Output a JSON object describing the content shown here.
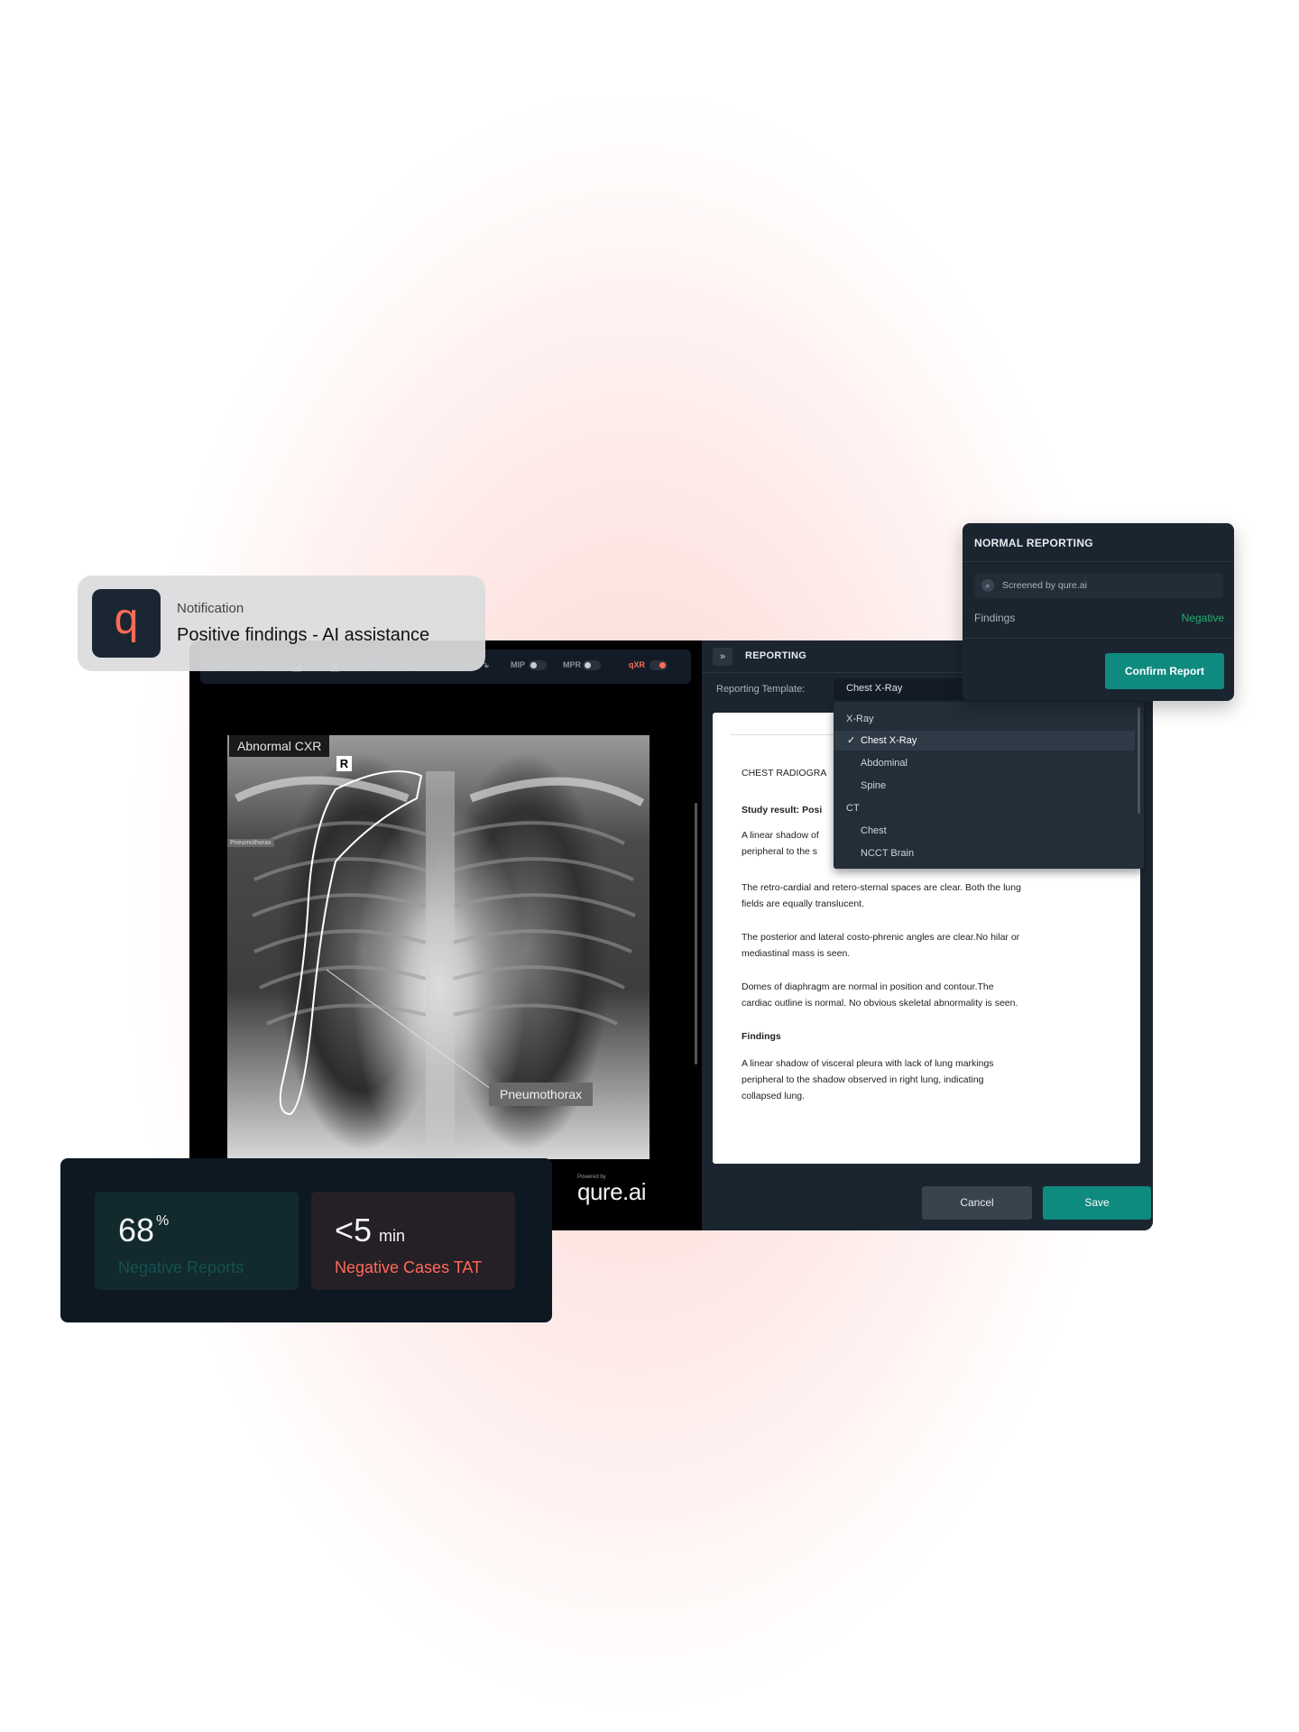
{
  "notification": {
    "title": "Notification",
    "message": "Positive findings - AI assistance",
    "logo_glyph": "q"
  },
  "toolbar": {
    "mip_label": "MIP",
    "mpr_label": "MPR",
    "qxr_label": "qXR",
    "qxr_on": true
  },
  "viewer": {
    "abnormal_label": "Abnormal CXR",
    "r_marker": "R",
    "small_label": "Pneumothorax",
    "finding_label": "Pneumothorax"
  },
  "reporting": {
    "title": "REPORTING",
    "template_label": "Reporting Template:",
    "template_value": "Chest X-Ray",
    "dropdown": [
      {
        "label": "X-Ray",
        "type": "group"
      },
      {
        "label": "Chest X-Ray",
        "type": "item",
        "selected": true
      },
      {
        "label": "Abdominal",
        "type": "item"
      },
      {
        "label": "Spine",
        "type": "item"
      },
      {
        "label": "CT",
        "type": "group"
      },
      {
        "label": "Chest",
        "type": "item"
      },
      {
        "label": "NCCT Brain",
        "type": "item"
      }
    ],
    "doc": {
      "heading": "CHEST RADIOGRA",
      "study_result": "Study result: Posi",
      "p1a": "A linear shadow of",
      "p1b": "peripheral to the s",
      "p2a": "The retro-cardial and retero-sternal spaces are clear. Both the lung",
      "p2b": "fields are equally translucent.",
      "p3a": "The posterior and lateral costo-phrenic angles are clear.No hilar or",
      "p3b": "mediastinal mass is seen.",
      "p4a": "Domes of diaphragm are normal in position and contour.The",
      "p4b": "cardiac outline is normal. No obvious skeletal abnormality is seen.",
      "findings_title": "Findings",
      "f1": "A linear shadow of visceral pleura with lack of lung markings",
      "f2": "peripheral to the shadow observed in right lung, indicating",
      "f3": "collapsed lung."
    },
    "cancel": "Cancel",
    "save": "Save"
  },
  "normal_reporting": {
    "title": "NORMAL REPORTING",
    "search_text": "Screened by qure.ai",
    "findings_label": "Findings",
    "findings_value": "Negative",
    "confirm": "Confirm Report"
  },
  "stats": {
    "negative_reports": {
      "value": "68",
      "sup": "%",
      "label": "Negative Reports",
      "color": "#13514f"
    },
    "negative_tat": {
      "value": "<5",
      "unit": "min",
      "label": "Negative Cases TAT",
      "color": "#ff6b57"
    }
  },
  "branding": {
    "powered_by": "Powered by",
    "logo": "qure.ai"
  },
  "colors": {
    "accent": "#0f8a7f",
    "negative": "#1bb36e",
    "alert": "#ff6b57"
  }
}
